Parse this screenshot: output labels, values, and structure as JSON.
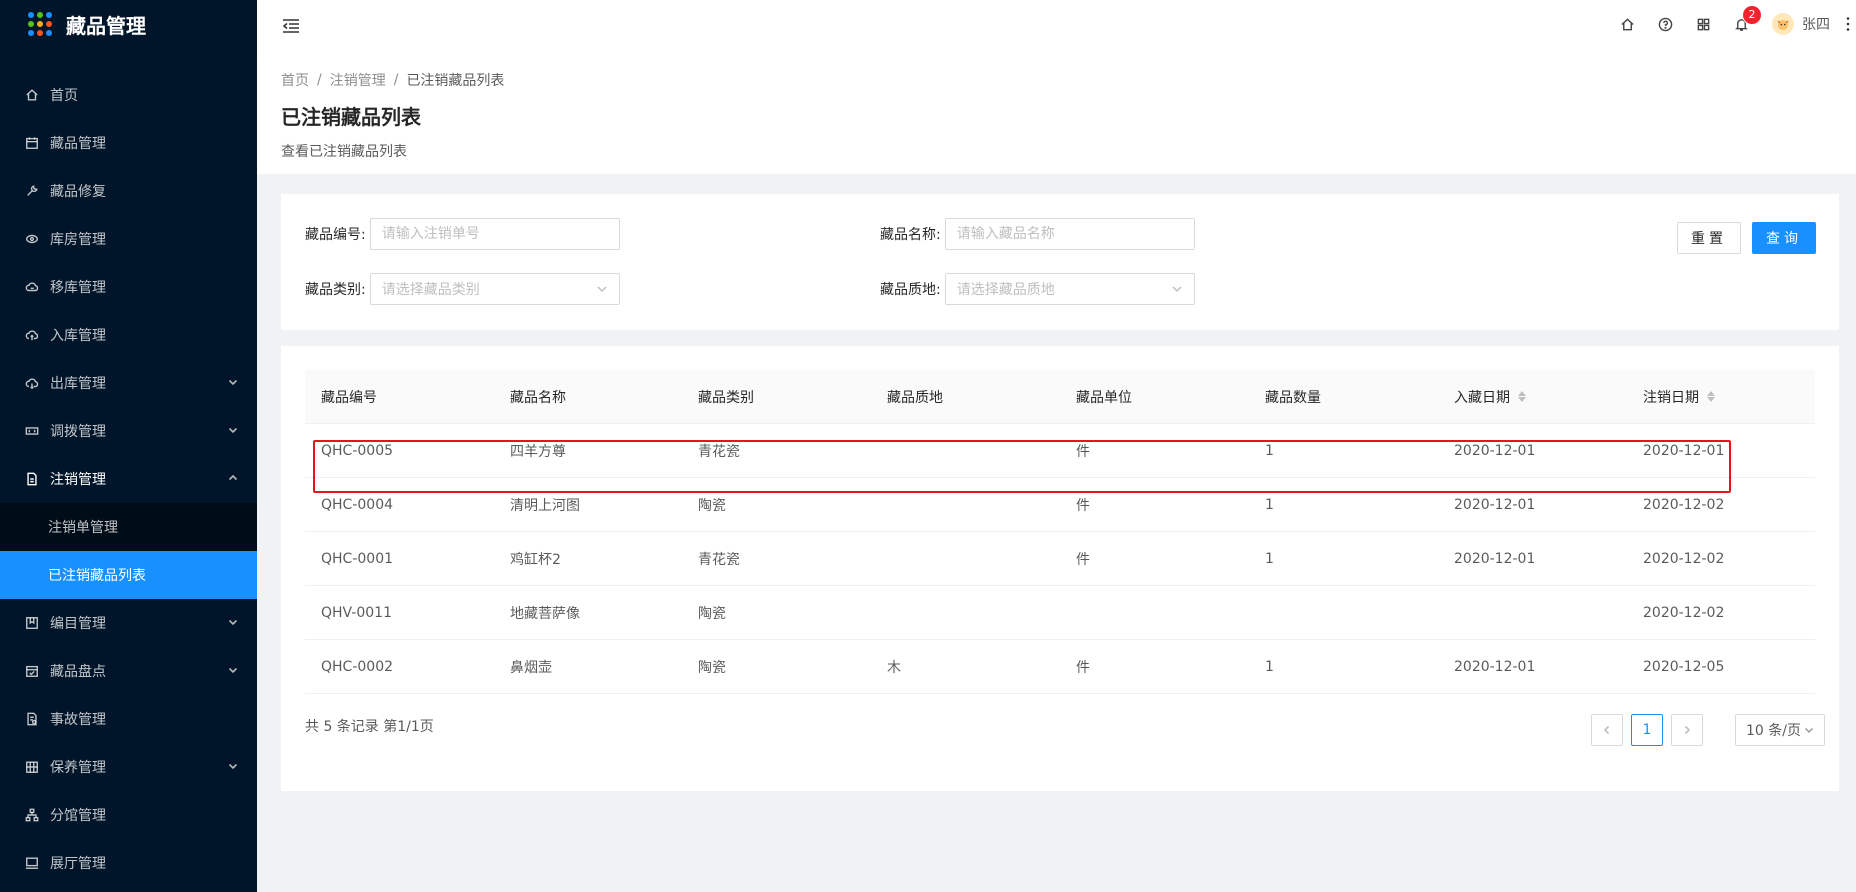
{
  "app": {
    "title": "藏品管理"
  },
  "sidebar": {
    "items": [
      {
        "label": "首页",
        "icon": "home-icon"
      },
      {
        "label": "藏品管理",
        "icon": "calendar-icon"
      },
      {
        "label": "藏品修复",
        "icon": "wrench-icon"
      },
      {
        "label": "库房管理",
        "icon": "warehouse-icon"
      },
      {
        "label": "移库管理",
        "icon": "cloud-transfer-icon"
      },
      {
        "label": "入库管理",
        "icon": "cloud-upload-icon"
      },
      {
        "label": "出库管理",
        "icon": "cloud-download-icon"
      },
      {
        "label": "调拨管理",
        "icon": "transfer-icon"
      },
      {
        "label": "注销管理",
        "icon": "file-icon"
      },
      {
        "label": "编目管理",
        "icon": "catalog-icon"
      },
      {
        "label": "藏品盘点",
        "icon": "inventory-icon"
      },
      {
        "label": "事故管理",
        "icon": "incident-icon"
      },
      {
        "label": "保养管理",
        "icon": "maintenance-icon"
      },
      {
        "label": "分馆管理",
        "icon": "branch-icon"
      },
      {
        "label": "展厅管理",
        "icon": "monitor-icon"
      }
    ],
    "submenu": [
      {
        "label": "注销单管理"
      },
      {
        "label": "已注销藏品列表"
      }
    ]
  },
  "header": {
    "notification_count": "2",
    "user_name": "张四"
  },
  "breadcrumb": [
    "首页",
    "注销管理",
    "已注销藏品列表"
  ],
  "page": {
    "title": "已注销藏品列表",
    "description": "查看已注销藏品列表"
  },
  "search": {
    "code_label": "藏品编号:",
    "code_placeholder": "请输入注销单号",
    "name_label": "藏品名称:",
    "name_placeholder": "请输入藏品名称",
    "category_label": "藏品类别:",
    "category_placeholder": "请选择藏品类别",
    "material_label": "藏品质地:",
    "material_placeholder": "请选择藏品质地",
    "reset_label": "重置",
    "query_label": "查询"
  },
  "table": {
    "columns": [
      "藏品编号",
      "藏品名称",
      "藏品类别",
      "藏品质地",
      "藏品单位",
      "藏品数量",
      "入藏日期",
      "注销日期"
    ],
    "rows": [
      [
        "QHC-0005",
        "四羊方尊",
        "青花瓷",
        "",
        "件",
        "1",
        "2020-12-01",
        "2020-12-01"
      ],
      [
        "QHC-0004",
        "清明上河图",
        "陶瓷",
        "",
        "件",
        "1",
        "2020-12-01",
        "2020-12-02"
      ],
      [
        "QHC-0001",
        "鸡缸杯2",
        "青花瓷",
        "",
        "件",
        "1",
        "2020-12-01",
        "2020-12-02"
      ],
      [
        "QHV-0011",
        "地藏菩萨像",
        "陶瓷",
        "",
        "",
        "",
        "",
        "2020-12-02"
      ],
      [
        "QHC-0002",
        "鼻烟壶",
        "陶瓷",
        "木",
        "件",
        "1",
        "2020-12-01",
        "2020-12-05"
      ]
    ]
  },
  "pagination": {
    "summary": "共 5 条记录 第1/1页",
    "current_page": "1",
    "page_size": "10 条/页"
  },
  "colors": {
    "sidebar_bg": "#001529",
    "accent": "#1890ff",
    "highlight": "#e8141b"
  }
}
